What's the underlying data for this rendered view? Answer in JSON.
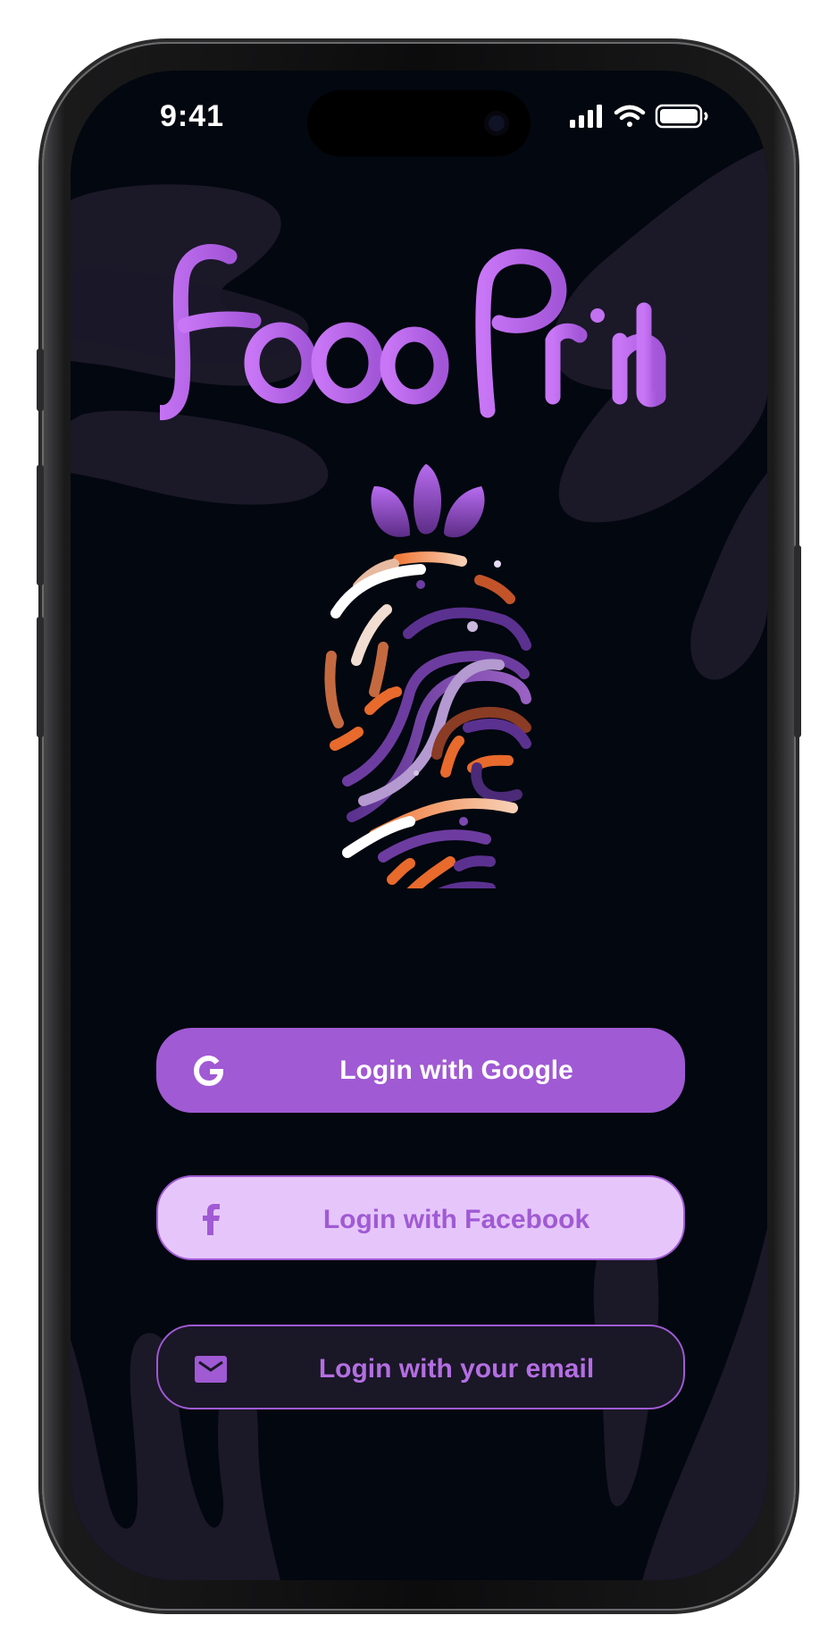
{
  "status_bar": {
    "time": "9:41"
  },
  "app": {
    "name": "Food Print"
  },
  "buttons": {
    "google": {
      "label": "Login with Google",
      "icon": "google-g-icon"
    },
    "facebook": {
      "label": "Login with Facebook",
      "icon": "facebook-f-icon"
    },
    "email": {
      "label": "Login with your email",
      "icon": "envelope-icon"
    }
  },
  "colors": {
    "background": "#03070f",
    "accent": "#a05ad4",
    "accent_light": "#e6c6fa",
    "logo_text": "#c56ef2",
    "orange": "#e86a2c"
  }
}
